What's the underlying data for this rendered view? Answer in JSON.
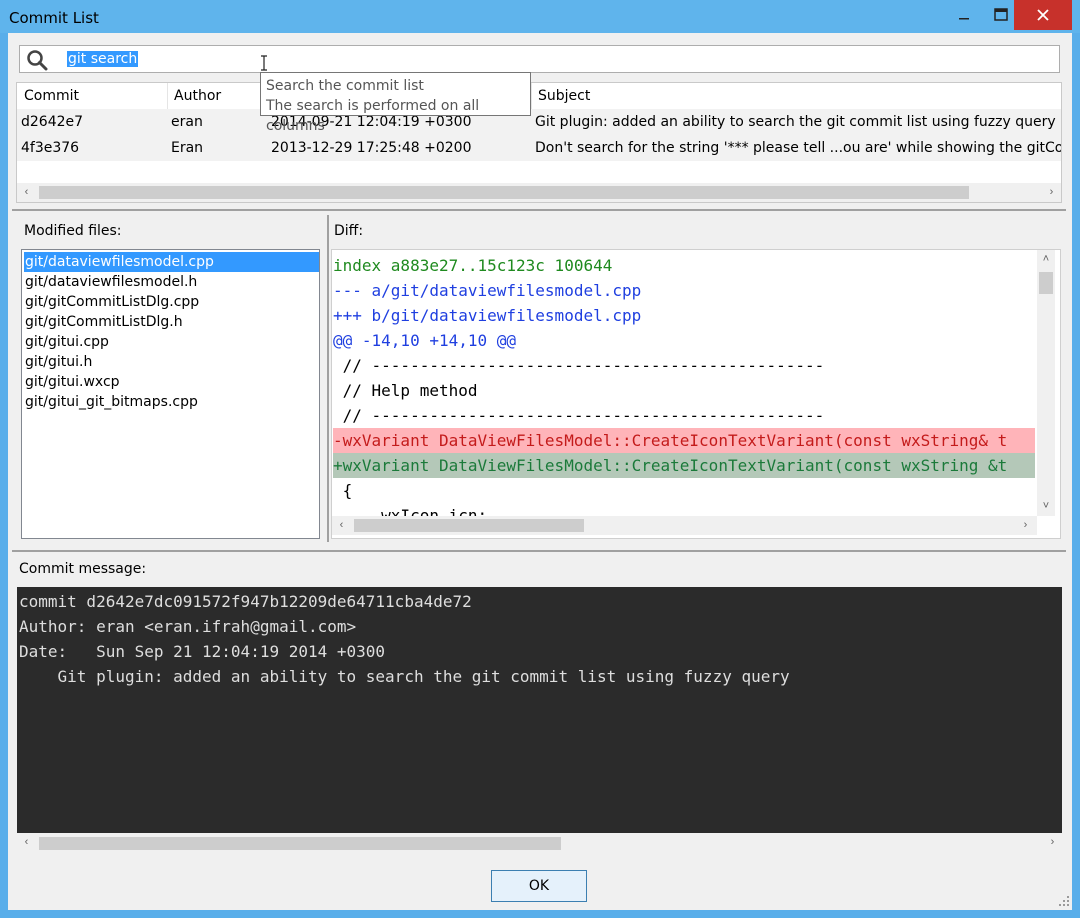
{
  "window": {
    "title": "Commit List"
  },
  "search": {
    "value": "git search"
  },
  "tooltip": {
    "line1": "Search the commit list",
    "line2": "The search is performed on all columns"
  },
  "grid": {
    "columns": [
      "Commit",
      "Author",
      "",
      "Subject"
    ],
    "rows": [
      {
        "commit": "d2642e7",
        "author": "eran",
        "date": "2014-09-21 12:04:19 +0300",
        "subject": "Git plugin: added an ability to search the git commit list using fuzzy query"
      },
      {
        "commit": "4f3e376",
        "author": "Eran",
        "date": "2013-12-29 17:25:48 +0200",
        "subject": "Don't search for the string '*** please tell ...ou are' while showing the gitCommitl"
      }
    ]
  },
  "modified_files": {
    "label": "Modified files:",
    "items": [
      "git/dataviewfilesmodel.cpp",
      "git/dataviewfilesmodel.h",
      "git/gitCommitListDlg.cpp",
      "git/gitCommitListDlg.h",
      "git/gitui.cpp",
      "git/gitui.h",
      "git/gitui.wxcp",
      "git/gitui_git_bitmaps.cpp"
    ],
    "selected_index": 0
  },
  "diff": {
    "label": "Diff:",
    "lines": [
      {
        "text": "index a883e27..15c123c 100644",
        "kind": "green"
      },
      {
        "text": "--- a/git/dataviewfilesmodel.cpp",
        "kind": "blue"
      },
      {
        "text": "+++ b/git/dataviewfilesmodel.cpp",
        "kind": "blue"
      },
      {
        "text": "@@ -14,10 +14,10 @@",
        "kind": "blue"
      },
      {
        "text": " // -----------------------------------------------",
        "kind": "plain"
      },
      {
        "text": " // Help method",
        "kind": "plain"
      },
      {
        "text": " // -----------------------------------------------",
        "kind": "plain"
      },
      {
        "text": "-wxVariant DataViewFilesModel::CreateIconTextVariant(const wxString& t",
        "kind": "del"
      },
      {
        "text": "+wxVariant DataViewFilesModel::CreateIconTextVariant(const wxString &t",
        "kind": "add"
      },
      {
        "text": " {",
        "kind": "plain"
      },
      {
        "text": "     wxIcon icn;",
        "kind": "plain"
      }
    ]
  },
  "commit_message": {
    "label": "Commit message:",
    "lines": [
      "commit d2642e7dc091572f947b12209de64711cba4de72",
      "Author: eran <eran.ifrah@gmail.com>",
      "Date:   Sun Sep 21 12:04:19 2014 +0300",
      "    Git plugin: added an ability to search the git commit list using fuzzy query"
    ]
  },
  "buttons": {
    "ok": "OK"
  },
  "colors": {
    "titlebar": "#5fb4ec",
    "close": "#c7312b",
    "selection": "#3399ff",
    "diff_del_bg": "#ffb4b9",
    "diff_add_bg": "#b4c8b8",
    "message_bg": "#2b2b2b"
  }
}
